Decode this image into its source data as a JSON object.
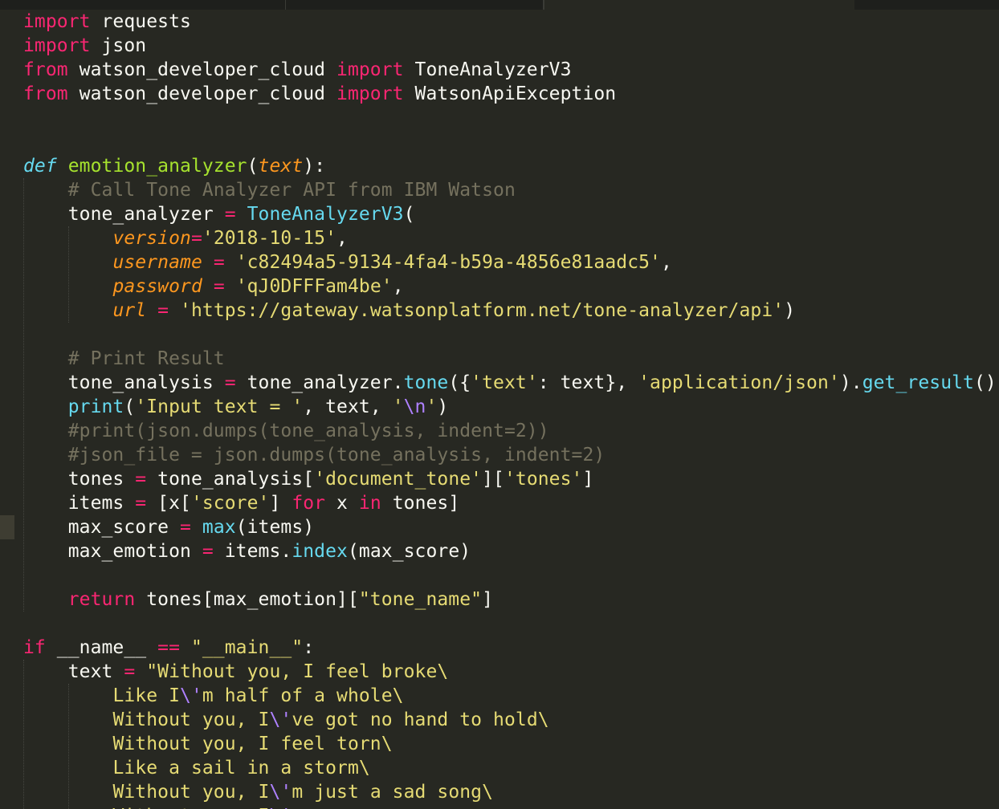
{
  "editor": {
    "theme": "monokai",
    "colors": {
      "background": "#272822",
      "keyword": "#f92672",
      "function": "#a6e22e",
      "parameter": "#fd971f",
      "string": "#e6db74",
      "comment": "#75715e",
      "builtin": "#66d9ef",
      "escape": "#ae81ff",
      "plain": "#f8f8f2"
    },
    "current_line": 22,
    "lines": [
      [
        [
          "kw",
          "import"
        ],
        [
          "pl",
          " requests"
        ]
      ],
      [
        [
          "kw",
          "import"
        ],
        [
          "pl",
          " json"
        ]
      ],
      [
        [
          "kw",
          "from"
        ],
        [
          "pl",
          " watson_developer_cloud "
        ],
        [
          "kw",
          "import"
        ],
        [
          "pl",
          " ToneAnalyzerV3"
        ]
      ],
      [
        [
          "kw",
          "from"
        ],
        [
          "pl",
          " watson_developer_cloud "
        ],
        [
          "kw",
          "import"
        ],
        [
          "pl",
          " WatsonApiException"
        ]
      ],
      [],
      [],
      [
        [
          "def",
          "def"
        ],
        [
          "pl",
          " "
        ],
        [
          "fn",
          "emotion_analyzer"
        ],
        [
          "pl",
          "("
        ],
        [
          "param",
          "text"
        ],
        [
          "pl",
          "):"
        ]
      ],
      [
        [
          "pl",
          "    "
        ],
        [
          "cm",
          "# Call Tone Analyzer API from IBM Watson"
        ]
      ],
      [
        [
          "pl",
          "    tone_analyzer "
        ],
        [
          "op",
          "="
        ],
        [
          "pl",
          " "
        ],
        [
          "bi",
          "ToneAnalyzerV3"
        ],
        [
          "pl",
          "("
        ]
      ],
      [
        [
          "pl",
          "        "
        ],
        [
          "param",
          "version"
        ],
        [
          "op",
          "="
        ],
        [
          "str",
          "'2018-10-15'"
        ],
        [
          "pl",
          ","
        ]
      ],
      [
        [
          "pl",
          "        "
        ],
        [
          "param",
          "username"
        ],
        [
          "pl",
          " "
        ],
        [
          "op",
          "="
        ],
        [
          "pl",
          " "
        ],
        [
          "str",
          "'c82494a5-9134-4fa4-b59a-4856e81aadc5'"
        ],
        [
          "pl",
          ","
        ]
      ],
      [
        [
          "pl",
          "        "
        ],
        [
          "param",
          "password"
        ],
        [
          "pl",
          " "
        ],
        [
          "op",
          "="
        ],
        [
          "pl",
          " "
        ],
        [
          "str",
          "'qJ0DFFFam4be'"
        ],
        [
          "pl",
          ","
        ]
      ],
      [
        [
          "pl",
          "        "
        ],
        [
          "param",
          "url"
        ],
        [
          "pl",
          " "
        ],
        [
          "op",
          "="
        ],
        [
          "pl",
          " "
        ],
        [
          "str",
          "'https://gateway.watsonplatform.net/tone-analyzer/api'"
        ],
        [
          "pl",
          ")"
        ]
      ],
      [],
      [
        [
          "pl",
          "    "
        ],
        [
          "cm",
          "# Print Result"
        ]
      ],
      [
        [
          "pl",
          "    tone_analysis "
        ],
        [
          "op",
          "="
        ],
        [
          "pl",
          " tone_analyzer."
        ],
        [
          "bi",
          "tone"
        ],
        [
          "pl",
          "({"
        ],
        [
          "str",
          "'text'"
        ],
        [
          "pl",
          ": text}, "
        ],
        [
          "str",
          "'application/json'"
        ],
        [
          "pl",
          ")."
        ],
        [
          "bi",
          "get_result"
        ],
        [
          "pl",
          "()"
        ]
      ],
      [
        [
          "pl",
          "    "
        ],
        [
          "bi",
          "print"
        ],
        [
          "pl",
          "("
        ],
        [
          "str",
          "'Input text = '"
        ],
        [
          "pl",
          ", text, "
        ],
        [
          "str",
          "'"
        ],
        [
          "esc",
          "\\n"
        ],
        [
          "str",
          "'"
        ],
        [
          "pl",
          ")"
        ]
      ],
      [
        [
          "pl",
          "    "
        ],
        [
          "cm",
          "#print(json.dumps(tone_analysis, indent=2))"
        ]
      ],
      [
        [
          "pl",
          "    "
        ],
        [
          "cm",
          "#json_file = json.dumps(tone_analysis, indent=2)"
        ]
      ],
      [
        [
          "pl",
          "    tones "
        ],
        [
          "op",
          "="
        ],
        [
          "pl",
          " tone_analysis["
        ],
        [
          "str",
          "'document_tone'"
        ],
        [
          "pl",
          "]["
        ],
        [
          "str",
          "'tones'"
        ],
        [
          "pl",
          "]"
        ]
      ],
      [
        [
          "pl",
          "    items "
        ],
        [
          "op",
          "="
        ],
        [
          "pl",
          " [x["
        ],
        [
          "str",
          "'score'"
        ],
        [
          "pl",
          "] "
        ],
        [
          "kw",
          "for"
        ],
        [
          "pl",
          " x "
        ],
        [
          "kw",
          "in"
        ],
        [
          "pl",
          " tones]"
        ]
      ],
      [
        [
          "pl",
          "    max_score "
        ],
        [
          "op",
          "="
        ],
        [
          "pl",
          " "
        ],
        [
          "bi",
          "max"
        ],
        [
          "pl",
          "(items"
        ],
        [
          "pl",
          ")"
        ]
      ],
      [
        [
          "pl",
          "    max_emotion "
        ],
        [
          "op",
          "="
        ],
        [
          "pl",
          " items."
        ],
        [
          "bi",
          "index"
        ],
        [
          "pl",
          "(max_score)"
        ]
      ],
      [],
      [
        [
          "pl",
          "    "
        ],
        [
          "kw",
          "return"
        ],
        [
          "pl",
          " tones[max_emotion]["
        ],
        [
          "str",
          "\"tone_name\""
        ],
        [
          "pl",
          "]"
        ]
      ],
      [],
      [
        [
          "kw",
          "if"
        ],
        [
          "pl",
          " __name__ "
        ],
        [
          "op",
          "=="
        ],
        [
          "pl",
          " "
        ],
        [
          "str",
          "\"__main__\""
        ],
        [
          "pl",
          ":"
        ]
      ],
      [
        [
          "pl",
          "    text "
        ],
        [
          "op",
          "="
        ],
        [
          "pl",
          " "
        ],
        [
          "str",
          "\"Without you, I feel broke\\"
        ]
      ],
      [
        [
          "pl",
          "        "
        ],
        [
          "str",
          "Like I"
        ],
        [
          "esc",
          "\\'"
        ],
        [
          "str",
          "m half of a whole\\"
        ]
      ],
      [
        [
          "pl",
          "        "
        ],
        [
          "str",
          "Without you, I"
        ],
        [
          "esc",
          "\\'"
        ],
        [
          "str",
          "ve got no hand to hold\\"
        ]
      ],
      [
        [
          "pl",
          "        "
        ],
        [
          "str",
          "Without you, I feel torn\\"
        ]
      ],
      [
        [
          "pl",
          "        "
        ],
        [
          "str",
          "Like a sail in a storm\\"
        ]
      ],
      [
        [
          "pl",
          "        "
        ],
        [
          "str",
          "Without you, I"
        ],
        [
          "esc",
          "\\'"
        ],
        [
          "str",
          "m just a sad song\\"
        ]
      ],
      [
        [
          "pl",
          "        "
        ],
        [
          "str",
          "Without you, I"
        ],
        [
          "esc",
          "\\'"
        ],
        [
          "str",
          "m..."
        ]
      ]
    ]
  }
}
